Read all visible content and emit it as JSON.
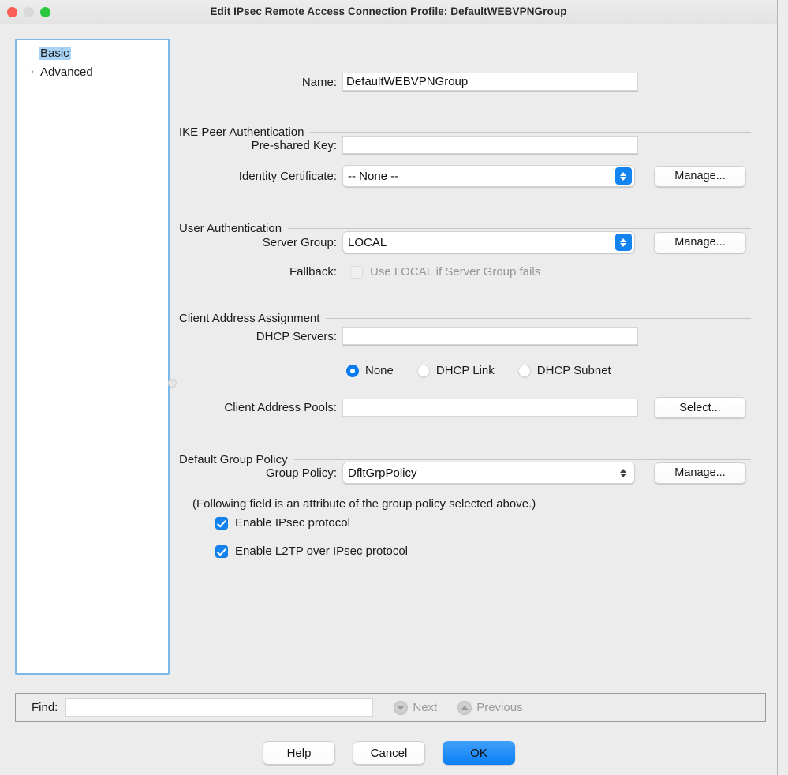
{
  "window": {
    "title": "Edit IPsec Remote Access Connection Profile: DefaultWEBVPNGroup",
    "traffic_lights": [
      "close",
      "minimize",
      "zoom"
    ],
    "accent_color": "#1383f0",
    "selection_color": "#a8d3f7",
    "focus_ring_color": "#7bb8e8"
  },
  "sidebar": {
    "items": [
      {
        "label": "Basic",
        "selected": true,
        "has_disclosure": false
      },
      {
        "label": "Advanced",
        "selected": false,
        "has_disclosure": true,
        "disclosure_glyph": "›"
      }
    ]
  },
  "form": {
    "name": {
      "label": "Name:",
      "value": "DefaultWEBVPNGroup",
      "placeholder": ""
    },
    "ike_peer_authentication": {
      "title": "IKE Peer Authentication",
      "pre_shared_key": {
        "label": "Pre-shared Key:",
        "value": "",
        "placeholder": ""
      },
      "identity_certificate": {
        "label": "Identity Certificate:",
        "value": "-- None --",
        "options": [
          "-- None --"
        ],
        "manage_label": "Manage..."
      }
    },
    "user_authentication": {
      "title": "User Authentication",
      "server_group": {
        "label": "Server Group:",
        "value": "LOCAL",
        "options": [
          "LOCAL"
        ],
        "manage_label": "Manage..."
      },
      "fallback": {
        "label": "Fallback:",
        "checkbox_label": "Use LOCAL if Server Group fails",
        "checked": false,
        "disabled": true
      }
    },
    "client_address_assignment": {
      "title": "Client Address Assignment",
      "dhcp_servers": {
        "label": "DHCP Servers:",
        "value": "",
        "placeholder": ""
      },
      "dhcp_mode": {
        "options": [
          {
            "label": "None",
            "selected": true
          },
          {
            "label": "DHCP Link",
            "selected": false
          },
          {
            "label": "DHCP Subnet",
            "selected": false
          }
        ]
      },
      "client_address_pools": {
        "label": "Client Address Pools:",
        "value": "",
        "placeholder": "",
        "select_label": "Select..."
      }
    },
    "default_group_policy": {
      "title": "Default Group Policy",
      "group_policy": {
        "label": "Group Policy:",
        "value": "DfltGrpPolicy",
        "options": [
          "DfltGrpPolicy"
        ],
        "manage_label": "Manage..."
      },
      "note": "(Following field is an attribute of the group policy selected above.)",
      "checkboxes": [
        {
          "label": "Enable IPsec protocol",
          "checked": true
        },
        {
          "label": "Enable L2TP over IPsec protocol",
          "checked": true
        }
      ]
    }
  },
  "find_bar": {
    "label": "Find:",
    "value": "",
    "placeholder": "",
    "next_label": "Next",
    "previous_label": "Previous",
    "next_disabled": true,
    "previous_disabled": true
  },
  "buttons": {
    "help": "Help",
    "cancel": "Cancel",
    "ok": "OK"
  }
}
